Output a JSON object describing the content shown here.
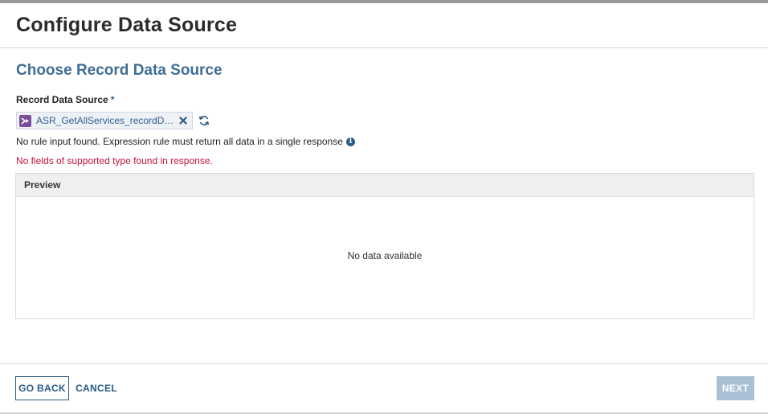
{
  "dialog": {
    "title": "Configure Data Source"
  },
  "section": {
    "title": "Choose Record Data Source"
  },
  "field": {
    "label": "Record Data Source",
    "required_marker": "*",
    "value": "ASR_GetAllServices_recordData...",
    "value_icon": "expression-rule-icon",
    "remove_icon": "close-icon",
    "refresh_icon": "refresh-icon"
  },
  "messages": {
    "info": "No rule input found. Expression rule must return all data in a single response",
    "info_icon": "info-icon",
    "error": "No fields of supported type found in response."
  },
  "preview": {
    "header": "Preview",
    "empty_text": "No data available"
  },
  "footer": {
    "back_label": "GO BACK",
    "cancel_label": "CANCEL",
    "next_label": "NEXT"
  },
  "colors": {
    "accent": "#2b5a84",
    "section_title": "#3f6e96",
    "error": "#c4133c",
    "next_disabled": "#a9c0d4",
    "chip_icon": "#7b4e9b"
  }
}
